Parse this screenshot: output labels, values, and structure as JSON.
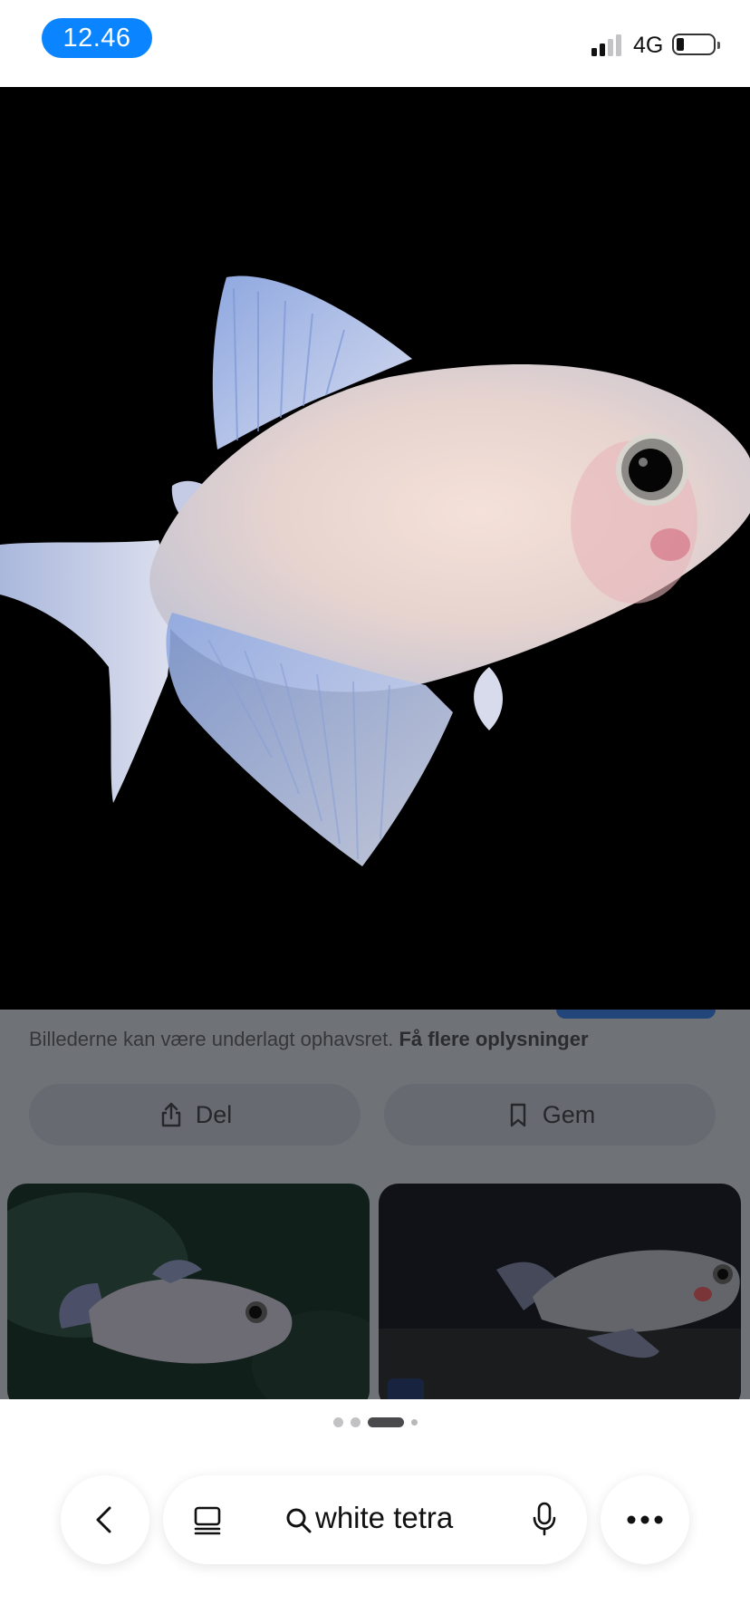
{
  "status_bar": {
    "time": "12.46",
    "network": "4G",
    "signal_bars_active": 2,
    "signal_bars_total": 4,
    "battery_level": 0.15
  },
  "image_viewer": {
    "main_image_icon": "fish-photo",
    "copyright_text": "Billederne kan være underlagt ophavsret.",
    "copyright_link": "Få flere oplysninger",
    "share_button": {
      "label": "Del",
      "icon": "share-icon"
    },
    "save_button": {
      "label": "Gem",
      "icon": "bookmark-icon"
    },
    "related_images": [
      {
        "icon": "fish-photo"
      },
      {
        "icon": "fish-photo"
      }
    ]
  },
  "page_indicator": {
    "count": 4,
    "active_index": 2
  },
  "toolbar": {
    "back_icon": "chevron-left-icon",
    "tabs_icon": "tabs-icon",
    "search_query": "white tetra",
    "mic_icon": "microphone-icon",
    "more_icon": "more-icon"
  },
  "colors": {
    "accent": "#0a84ff",
    "overlay": "#6f7277"
  }
}
